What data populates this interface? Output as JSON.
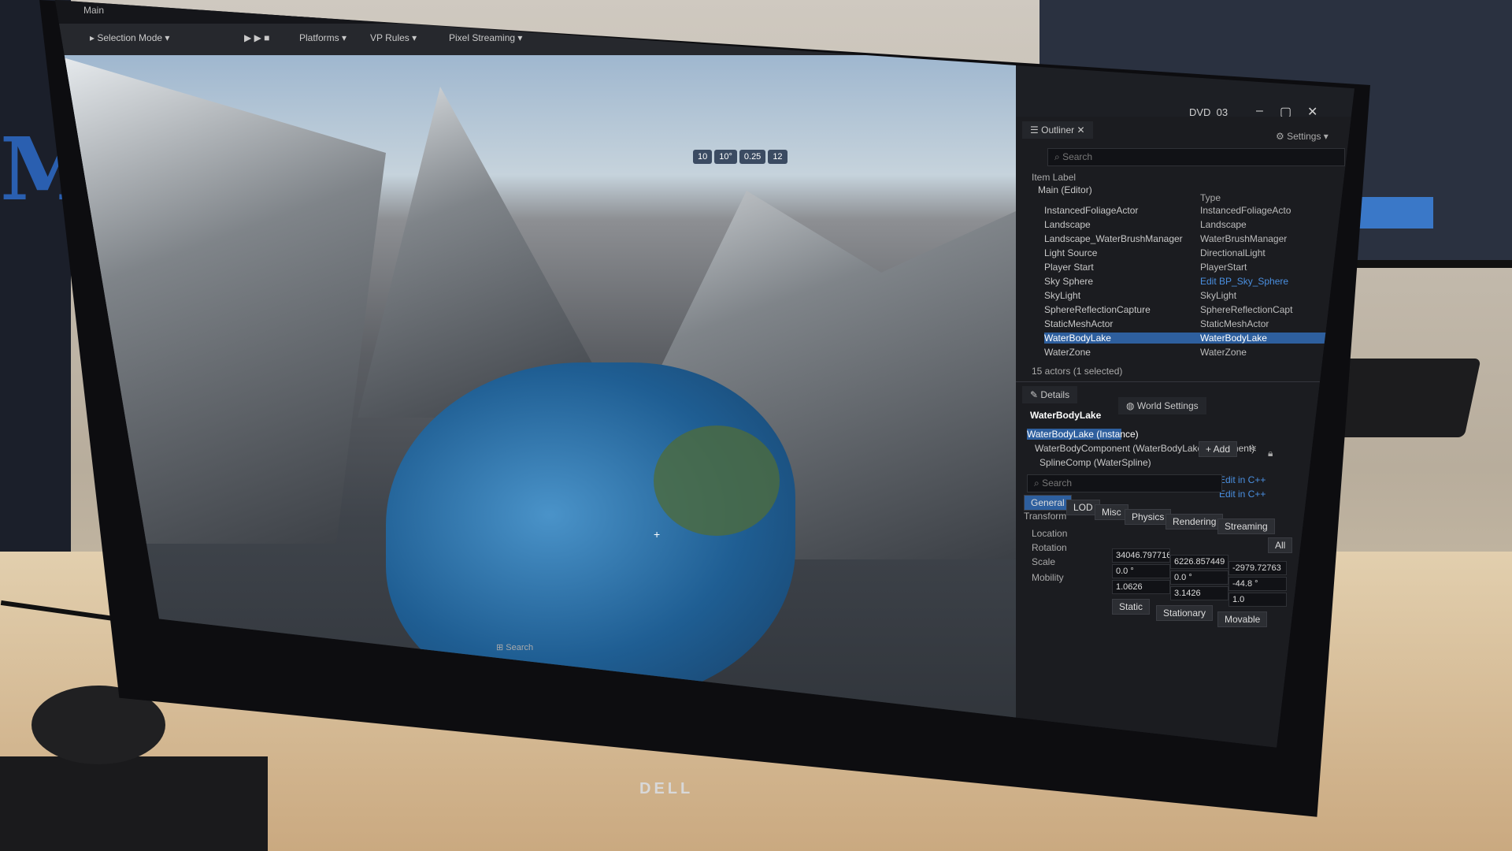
{
  "menubar": {
    "title": "Main"
  },
  "toolbar": {
    "selection_mode": "Selection Mode",
    "platforms": "Platforms",
    "vp_rules": "VP Rules",
    "pixel_streaming": "Pixel Streaming"
  },
  "window": {
    "title": "DVD_03",
    "minimize": "–",
    "maximize": "▢",
    "close": "✕"
  },
  "outliner": {
    "tab": "Outliner",
    "settings": "Settings",
    "search_placeholder": "Search",
    "col_item": "Item Label",
    "col_type": "Type",
    "root": "Main (Editor)",
    "items": [
      {
        "label": "InstancedFoliageActor",
        "type": "InstancedFoliageActo"
      },
      {
        "label": "Landscape",
        "type": "Landscape"
      },
      {
        "label": "Landscape_WaterBrushManager",
        "type": "WaterBrushManager"
      },
      {
        "label": "Light Source",
        "type": "DirectionalLight"
      },
      {
        "label": "Player Start",
        "type": "PlayerStart"
      },
      {
        "label": "Sky Sphere",
        "type": "Edit BP_Sky_Sphere"
      },
      {
        "label": "SkyLight",
        "type": "SkyLight"
      },
      {
        "label": "SphereReflectionCapture",
        "type": "SphereReflectionCapt"
      },
      {
        "label": "StaticMeshActor",
        "type": "StaticMeshActor"
      },
      {
        "label": "WaterBodyLake",
        "type": "WaterBodyLake"
      },
      {
        "label": "WaterZone",
        "type": "WaterZone"
      }
    ],
    "status": "15 actors (1 selected)"
  },
  "details": {
    "tab": "Details",
    "world_tab": "World Settings",
    "object": "WaterBodyLake",
    "instance": "WaterBodyLake (Instance)",
    "components": [
      "WaterBodyComponent (WaterBodyLakeComponent)",
      "SplineComp (WaterSpline)"
    ],
    "add": "+ Add",
    "edit_cpp_1": "Edit in C++",
    "edit_cpp_2": "Edit in C++",
    "search_placeholder": "Search",
    "filters": [
      "General",
      "LOD",
      "Misc",
      "Physics",
      "Rendering",
      "Streaming",
      "All"
    ],
    "section": "Transform",
    "location_label": "Location",
    "rotation_label": "Rotation",
    "scale_label": "Scale",
    "mobility_label": "Mobility",
    "location": [
      "34046.797716",
      "6226.857449",
      "-2979.72763"
    ],
    "rotation": [
      "0.0 °",
      "0.0 °",
      "-44.8 °"
    ],
    "scale": [
      "1.0626",
      "3.1426",
      "1.0"
    ],
    "mobility": [
      "Static",
      "Stationary",
      "Movable"
    ]
  },
  "viewport": {
    "toolbar": [
      "10",
      "10°",
      "0.25",
      "12"
    ],
    "taskbar_search": "Search"
  },
  "brand": "DELL",
  "bg_logo": "M"
}
